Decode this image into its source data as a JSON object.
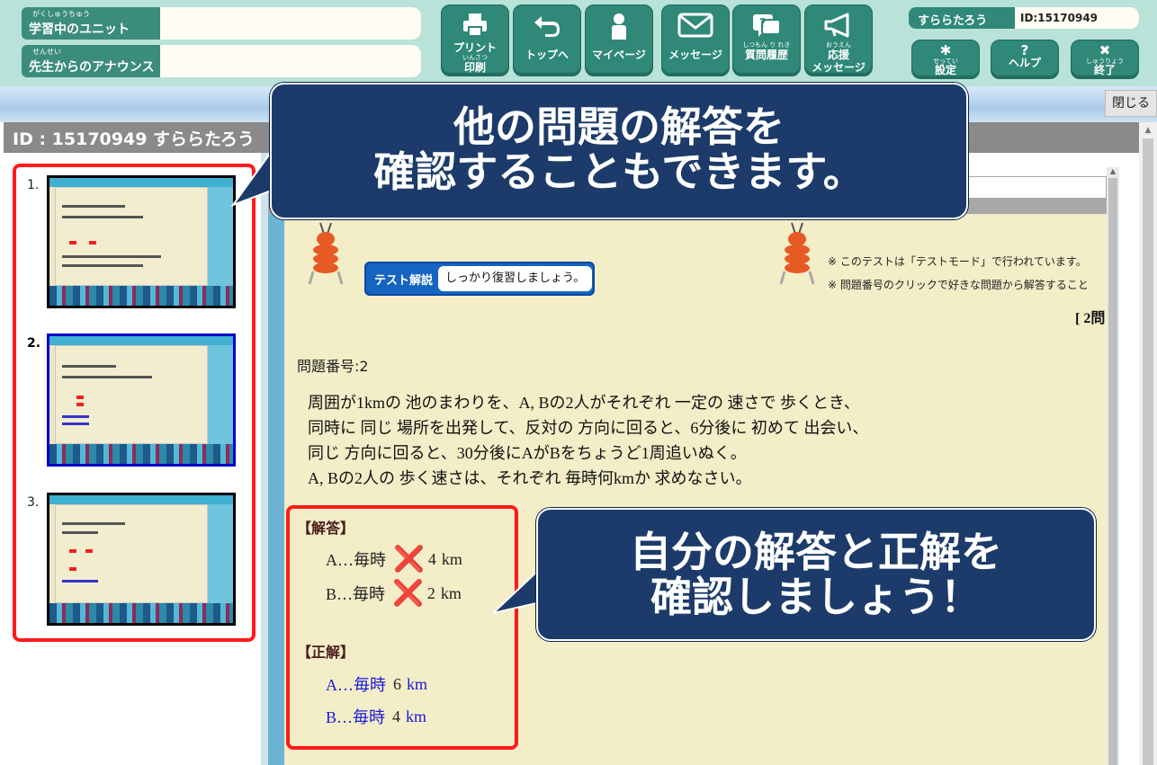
{
  "header": {
    "unit": {
      "label": "学習中のユニット",
      "ruby": "がくしゅうちゅう",
      "value": ""
    },
    "announce": {
      "label": "先生からのアナウンス",
      "ruby": "せんせい",
      "value": ""
    },
    "buttons": [
      {
        "label": "プリント",
        "sublabel_ruby": "いんさつ",
        "sublabel": "印刷",
        "icon": "printer-icon"
      },
      {
        "label": "トップへ",
        "icon": "return-arrow-icon"
      },
      {
        "label": "マイページ",
        "icon": "person-icon"
      },
      {
        "label": "メッセージ",
        "icon": "envelope-icon"
      },
      {
        "label_ruby": "しつもん り れき",
        "label": "質問履歴",
        "icon": "question-history-icon"
      },
      {
        "label_ruby": "おうえん",
        "label": "応援",
        "sublabel": "メッセージ",
        "icon": "megaphone-icon"
      }
    ],
    "user_name": "すららたろう",
    "user_id": "ID:15170949",
    "small_buttons": [
      {
        "ruby": "せってい",
        "label": "設定",
        "icon": "gear-icon",
        "glyph": "✱"
      },
      {
        "ruby": "",
        "label": "ヘルプ",
        "icon": "help-icon",
        "glyph": "?"
      },
      {
        "ruby": "しゅうりょう",
        "label": "終了",
        "icon": "close-icon",
        "glyph": "✖"
      }
    ]
  },
  "window": {
    "close_label": "閉じる",
    "title": "ID : 15170949 すららたろう"
  },
  "thumbnails": [
    {
      "number": "1.",
      "active": false
    },
    {
      "number": "2.",
      "active": true
    },
    {
      "number": "3.",
      "active": false
    }
  ],
  "content": {
    "badge_title": "テスト解説",
    "badge_text": "しっかり復習しましょう。",
    "notes": [
      "※ このテストは「テストモード」で行われています。",
      "※ 問題番号のクリックで好きな問題から解答すること"
    ],
    "page_marker": "[ 2問",
    "question_number": "問題番号:2",
    "question_lines": [
      "周囲が1kmの 池のまわりを、A, Bの2人がそれぞれ 一定の 速さで 歩くとき、",
      "同時に 同じ 場所を出発して、反対の 方向に回ると、6分後に 初めて 出会い、",
      "同じ 方向に回ると、30分後にAがBをちょうど1周追いぬく。",
      "A, Bの2人の 歩く速さは、それぞれ 毎時何kmか 求めなさい。"
    ],
    "answer_title": "【解答】",
    "answers": [
      {
        "prefix": "A…毎時",
        "mark": "❌",
        "value": "4",
        "unit": "km"
      },
      {
        "prefix": "B…毎時",
        "mark": "❌",
        "value": "2",
        "unit": "km"
      }
    ],
    "correct_title": "【正解】",
    "corrects": [
      {
        "prefix": "A…毎時",
        "value": "6",
        "unit": "km"
      },
      {
        "prefix": "B…毎時",
        "value": "4",
        "unit": "km"
      }
    ]
  },
  "callouts": {
    "top": [
      "他の問題の解答を",
      "確認することもできます。"
    ],
    "right": [
      "自分の解答と正解を",
      "確認しましょう！"
    ]
  },
  "colors": {
    "header_bg": "#b9e2d9",
    "button_green": "#2f8878",
    "callout_navy": "#1c3b6a",
    "highlight_red": "#ff1a1a",
    "wrong_mark": "#e51b1b",
    "correct_blue": "#1a1ad6"
  }
}
